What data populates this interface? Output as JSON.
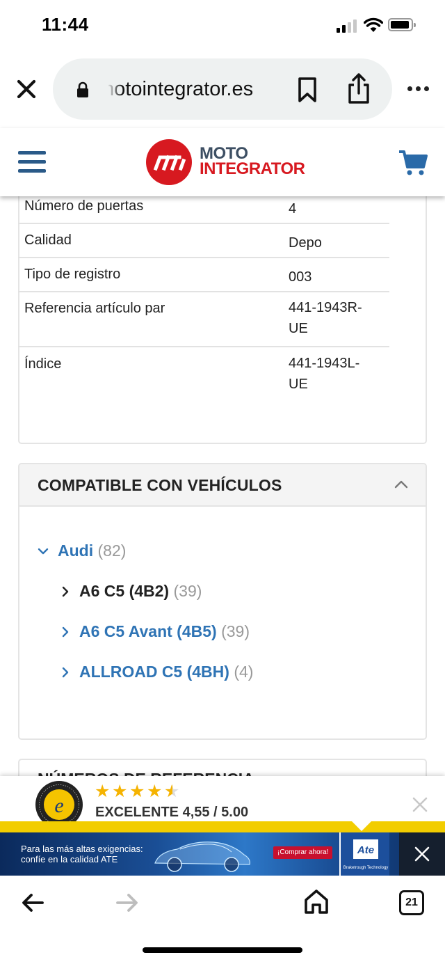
{
  "status_bar": {
    "time": "11:44"
  },
  "browser": {
    "url": "motointegrator.es",
    "tabs_count": "21"
  },
  "site": {
    "logo": {
      "line1": "MOTO",
      "line2": "INTEGRATOR"
    },
    "colors": {
      "brand_red": "#d71920",
      "brand_blue": "#2a5a88",
      "link_blue": "#2f74b5"
    }
  },
  "specs": [
    {
      "label": "Número de puertas",
      "value": "4"
    },
    {
      "label": "Calidad",
      "value": "Depo"
    },
    {
      "label": "Tipo de registro",
      "value": "003"
    },
    {
      "label": "Referencia artículo par",
      "value": "441-1943R-UE"
    },
    {
      "label": "Índice",
      "value": "441-1943L-UE"
    }
  ],
  "compatible": {
    "title": "COMPATIBLE CON VEHÍCULOS",
    "brand": {
      "name": "Audi",
      "count": "(82)"
    },
    "models": [
      {
        "name": "A6 C5 (4B2)",
        "count": "(39)"
      },
      {
        "name": "A6 C5 Avant (4B5)",
        "count": "(39)"
      },
      {
        "name": "ALLROAD C5 (4BH)",
        "count": "(4)"
      }
    ]
  },
  "next_section": {
    "title": "NÚMEROS DE REFERENCIA"
  },
  "trusted_shops": {
    "rating_text": "EXCELENTE 4,55 / 5.00",
    "rating_value": 4.55,
    "rating_max": 5
  },
  "ad": {
    "line1": "Para las más altas exigencias:",
    "line2": "confíe en la calidad ATE",
    "cta": "¡Comprar ahora!",
    "brand_caption": "Braketrough Technology"
  }
}
